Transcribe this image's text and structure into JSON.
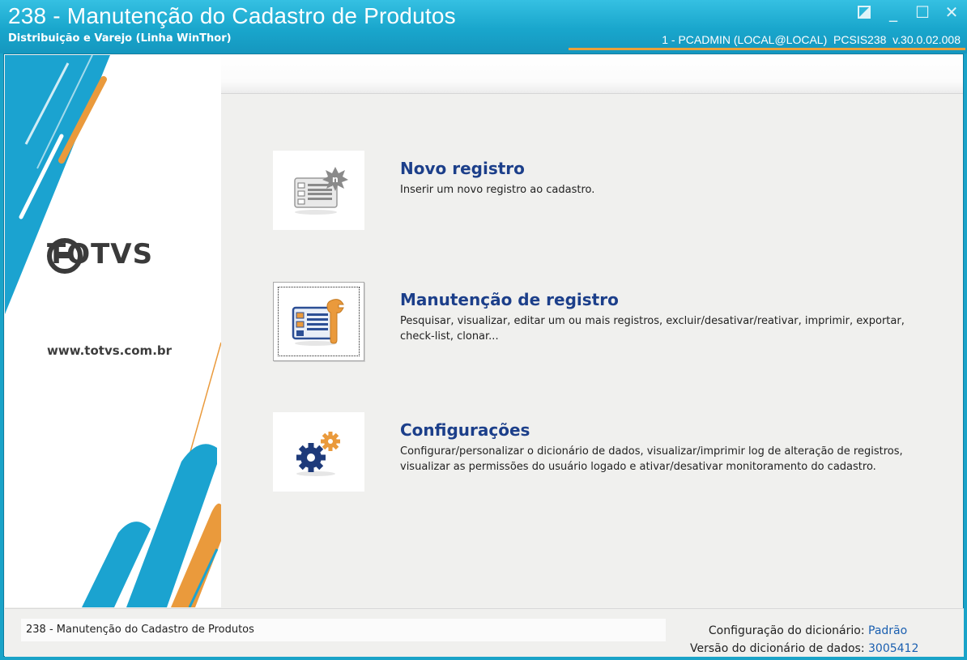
{
  "window": {
    "title": "238 - Manutenção do Cadastro de Produtos",
    "subtitle": "Distribuição e Varejo (Linha WinThor)",
    "session_info": "1 - PCADMIN (LOCAL@LOCAL)  PCSIS238  v.30.0.02.008",
    "controls": {
      "restore_icon": "restore-icon",
      "minimize_label": "_",
      "maximize_label": "☐",
      "close_label": "✕"
    }
  },
  "banner": {
    "brand": "TOTVS",
    "website": "www.totvs.com.br",
    "colors": {
      "blue": "#1ba3d0",
      "orange": "#ea9a3c"
    }
  },
  "options": [
    {
      "icon": "new-record-icon",
      "title": "Novo registro",
      "description": "Inserir um novo registro ao cadastro."
    },
    {
      "icon": "maintenance-record-icon",
      "title": "Manutenção de registro",
      "description": "Pesquisar, visualizar, editar um ou mais registros, excluir/desativar/reativar, imprimir, exportar, check-list,  clonar..."
    },
    {
      "icon": "gears-icon",
      "title": "Configurações",
      "description": "Configurar/personalizar o dicionário de dados, visualizar/imprimir log de alteração de registros, visualizar as permissões do usuário logado e ativar/desativar monitoramento do cadastro."
    }
  ],
  "statusbar": {
    "left_text": "238 - Manutenção do Cadastro de Produtos",
    "dict_config_label": "Configuração do dicionário:",
    "dict_config_value": "Padrão",
    "dict_version_label": "Versão do dicionário de dados:",
    "dict_version_value": "3005412"
  }
}
